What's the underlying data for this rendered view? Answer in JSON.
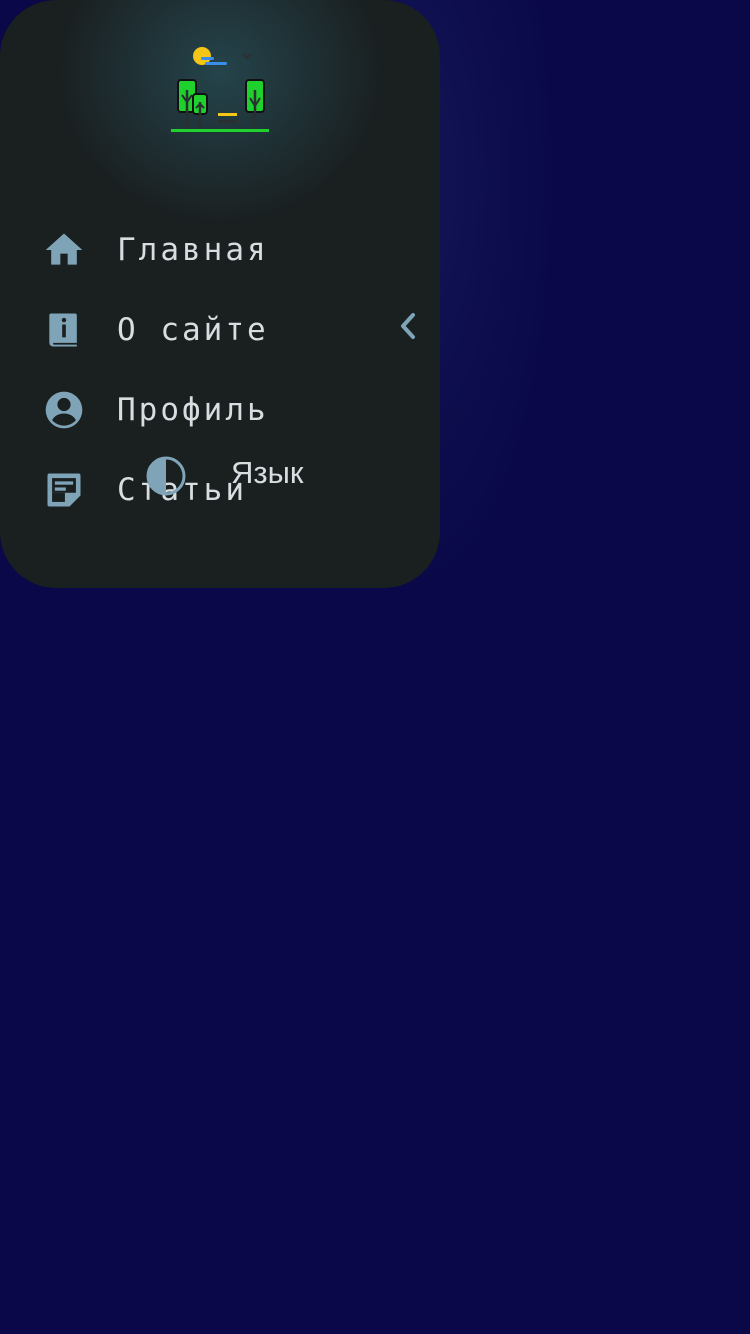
{
  "menu": {
    "items": [
      {
        "label": "Главная",
        "icon": "home-icon"
      },
      {
        "label": "О сайте",
        "icon": "info-book-icon"
      },
      {
        "label": "Профиль",
        "icon": "account-circle-icon"
      },
      {
        "label": "Статьи",
        "icon": "article-icon"
      }
    ],
    "expand_icon": "chevron-left-icon"
  },
  "controls": {
    "theme_icon": "contrast-icon",
    "language_label": "Язык"
  },
  "colors": {
    "background": "#0a0848",
    "drawer": "#1a1f20",
    "icon": "#7fa4b8",
    "text": "#d7dde0",
    "logo_green": "#1fd12c",
    "logo_sun": "#f5c518",
    "logo_cloud": "#3b8ee8"
  }
}
